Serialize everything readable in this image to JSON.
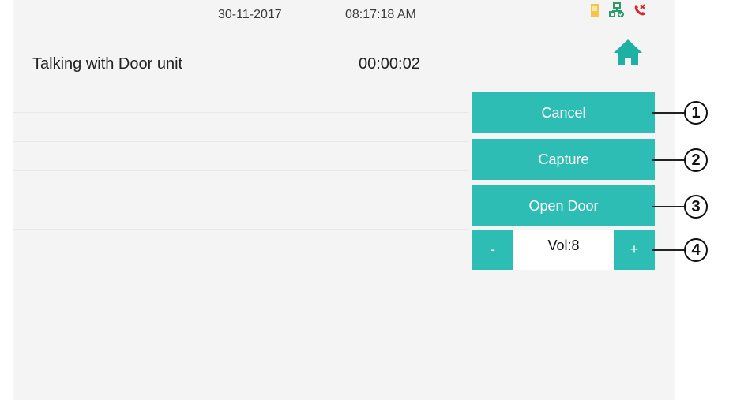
{
  "status": {
    "date": "30-11-2017",
    "time": "08:17:18 AM",
    "icons": [
      "sd-card-icon",
      "network-ok-icon",
      "missed-call-icon"
    ]
  },
  "call": {
    "title": "Talking with Door unit",
    "timer": "00:00:02"
  },
  "buttons": {
    "cancel": "Cancel",
    "capture": "Capture",
    "open_door": "Open Door",
    "vol_minus": "-",
    "vol_plus": "+",
    "volume": "Vol:8"
  },
  "callouts": [
    "1",
    "2",
    "3",
    "4"
  ],
  "colors": {
    "accent": "#2dbdb4",
    "background": "#f4f4f4",
    "home_icon": "#1fb0a5",
    "sd_icon": "#f3c64a",
    "network_icon": "#2b9a6a",
    "missed_call_icon": "#d8262c"
  }
}
